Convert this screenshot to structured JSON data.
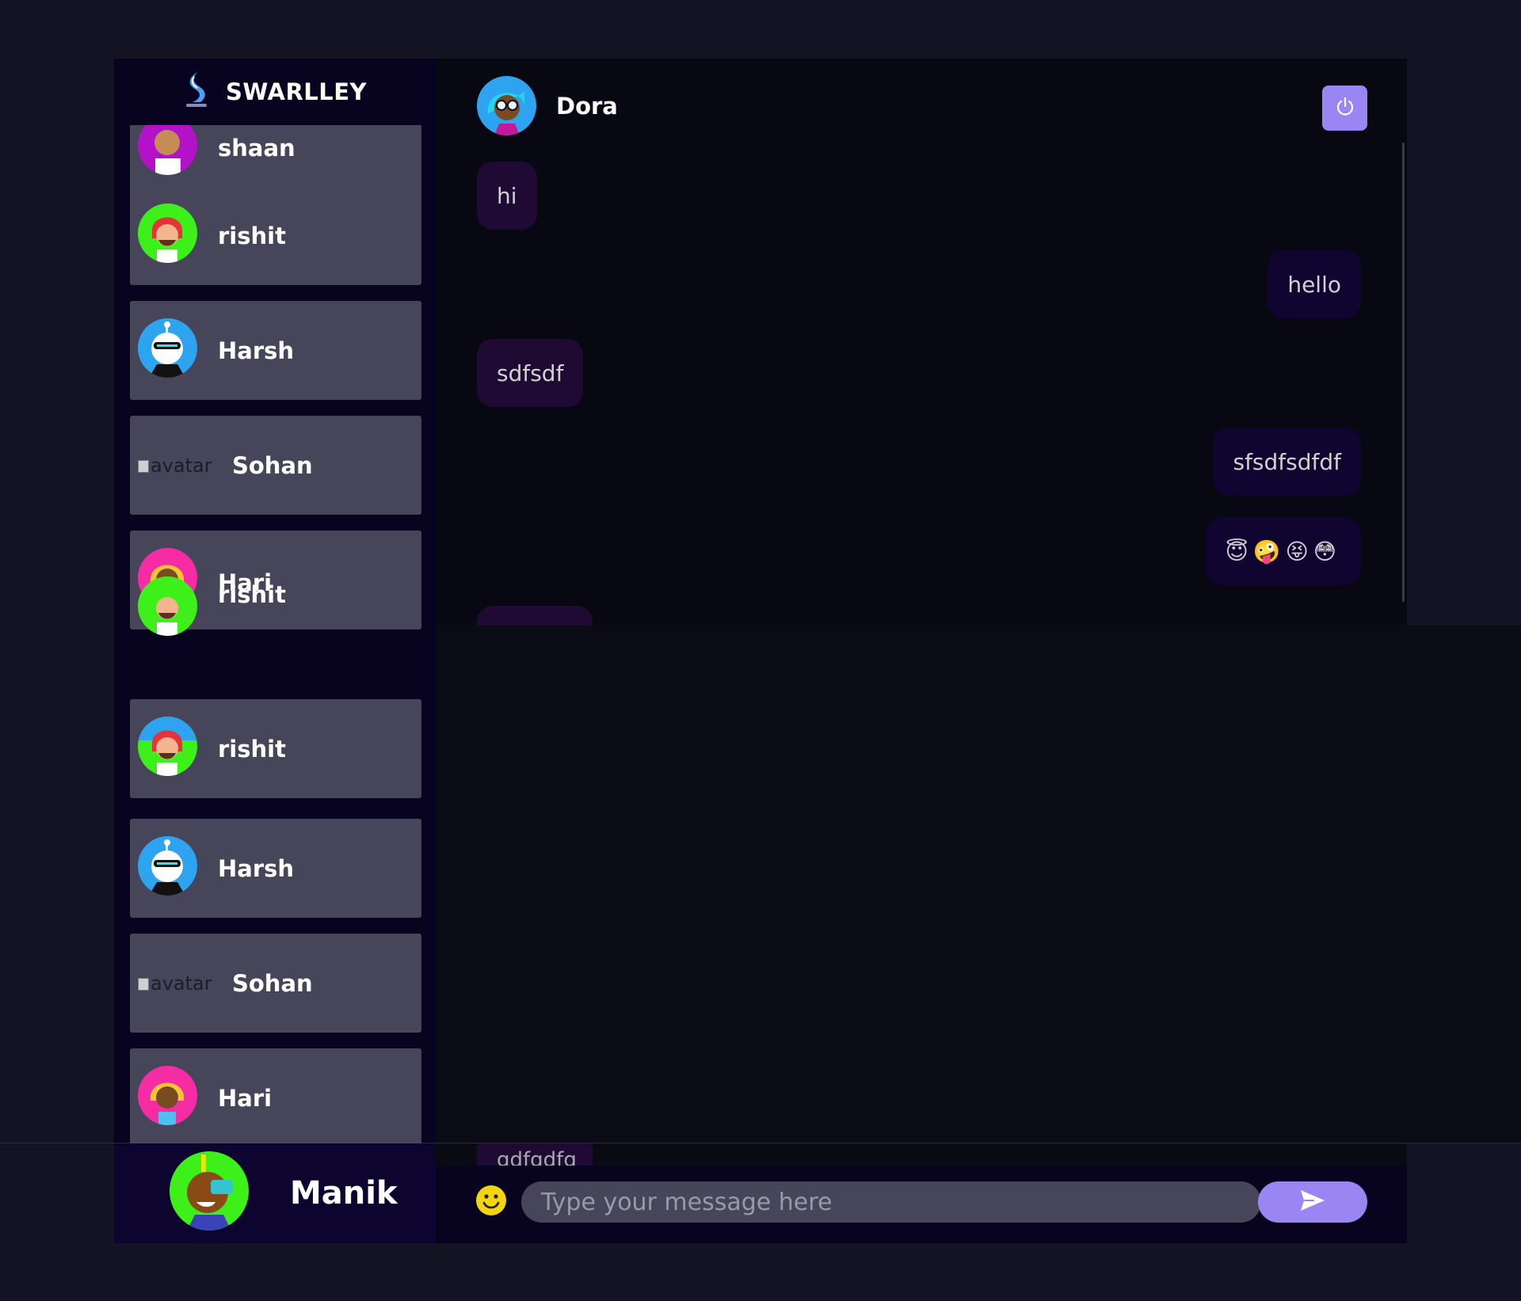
{
  "brand": {
    "title": "SWARLLEY"
  },
  "contacts": [
    {
      "name": "shaan"
    },
    {
      "name": "rishit"
    },
    {
      "name": "Harsh"
    },
    {
      "name": "Sohan",
      "avatar_alt": "avatar"
    },
    {
      "name": "Hari"
    },
    {
      "name": "rishit"
    },
    {
      "name": "rishit"
    },
    {
      "name": "Harsh"
    },
    {
      "name": "Sohan",
      "avatar_alt": "avatar"
    },
    {
      "name": "Hari"
    }
  ],
  "current_user": {
    "name": "Manik"
  },
  "chat": {
    "contact_name": "Dora",
    "messages": [
      {
        "text": "hi",
        "direction": "received"
      },
      {
        "text": "hello",
        "direction": "sent"
      },
      {
        "text": "sdfsdf",
        "direction": "received"
      },
      {
        "text": "sfsdfsdfdf",
        "direction": "sent"
      },
      {
        "text": "😇🤪😝😳",
        "direction": "sent"
      },
      {
        "text": "gdfgdfg",
        "direction": "received"
      }
    ]
  },
  "input": {
    "placeholder": "Type your message here"
  },
  "icons": {
    "logout": "power-icon",
    "emoji": "smiley-icon",
    "send": "send-arrow-icon",
    "brand": "logo-icon"
  },
  "colors": {
    "accent": "#9a86f3",
    "contact_card": "#474559",
    "sidebar": "#080420",
    "received_bubble": "#1e0a33",
    "sent_bubble": "#0f0530"
  }
}
